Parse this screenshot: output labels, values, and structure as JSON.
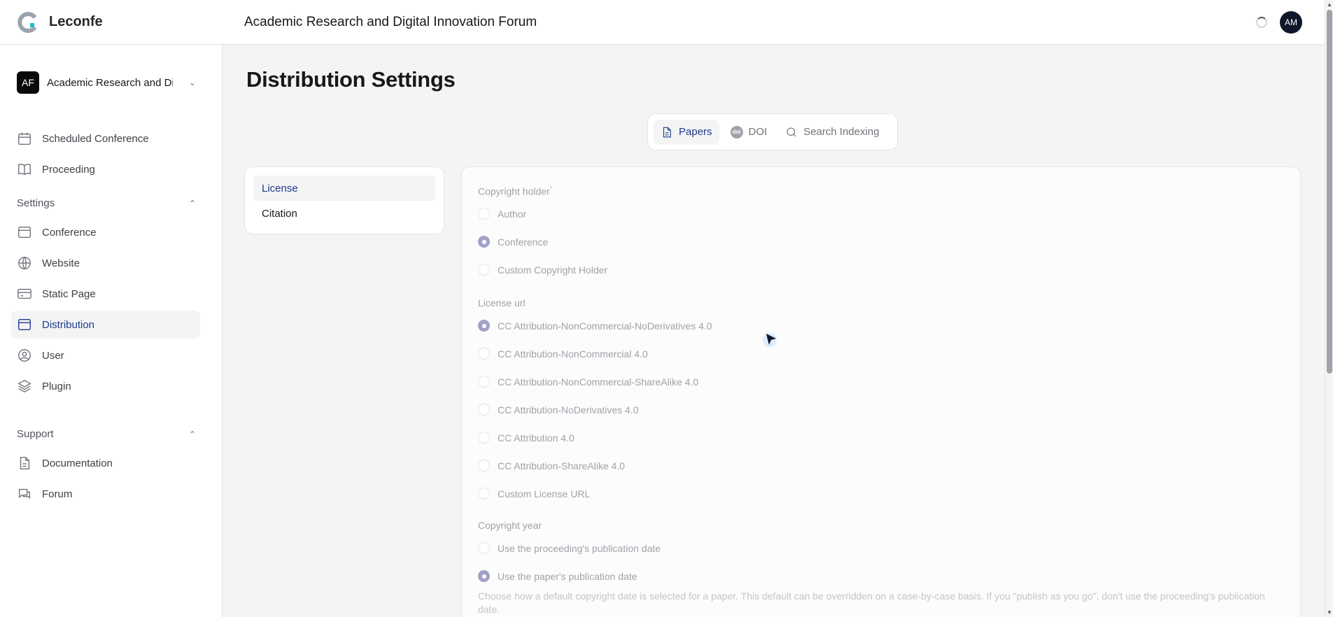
{
  "app": {
    "brand": "Leconfe",
    "forum_title": "Academic Research and Digital Innovation Forum",
    "avatar_initials": "AM"
  },
  "sidebar": {
    "conference": {
      "badge": "AF",
      "name": "Academic Research and Digital Innovation Forum"
    },
    "top_items": [
      {
        "label": "Scheduled Conference",
        "icon": "calendar-icon"
      },
      {
        "label": "Proceeding",
        "icon": "book-icon"
      }
    ],
    "settings_label": "Settings",
    "settings_items": [
      {
        "label": "Conference",
        "icon": "window-icon"
      },
      {
        "label": "Website",
        "icon": "globe-icon"
      },
      {
        "label": "Static Page",
        "icon": "card-icon"
      },
      {
        "label": "Distribution",
        "icon": "window-icon",
        "active": true
      },
      {
        "label": "User",
        "icon": "user-circle-icon"
      },
      {
        "label": "Plugin",
        "icon": "layers-icon"
      }
    ],
    "support_label": "Support",
    "support_items": [
      {
        "label": "Documentation",
        "icon": "document-icon"
      },
      {
        "label": "Forum",
        "icon": "chat-icon"
      }
    ]
  },
  "main": {
    "title": "Distribution Settings",
    "tabs": [
      {
        "label": "Papers",
        "icon": "document-icon",
        "active": true
      },
      {
        "label": "DOI",
        "icon": "doi-icon"
      },
      {
        "label": "Search Indexing",
        "icon": "search-icon"
      }
    ],
    "doi_icon_text": "doi",
    "subnav": [
      {
        "label": "License",
        "active": true
      },
      {
        "label": "Citation"
      }
    ],
    "form": {
      "copyright_holder": {
        "label": "Copyright holder",
        "required_mark": "*",
        "options": [
          "Author",
          "Conference",
          "Custom Copyright Holder"
        ],
        "selected": "Conference"
      },
      "license_url": {
        "label": "License url",
        "options": [
          "CC Attribution-NonCommercial-NoDerivatives 4.0",
          "CC Attribution-NonCommercial 4.0",
          "CC Attribution-NonCommercial-ShareAlike 4.0",
          "CC Attribution-NoDerivatives 4.0",
          "CC Attribution 4.0",
          "CC Attribution-ShareAlike 4.0",
          "Custom License URL"
        ],
        "selected": "CC Attribution-NonCommercial-NoDerivatives 4.0"
      },
      "copyright_year": {
        "label": "Copyright year",
        "options": [
          "Use the proceeding's publication date",
          "Use the paper's publication date"
        ],
        "selected": "Use the paper's publication date",
        "help": "Choose how a default copyright date is selected for a paper. This default can be overridden on a case-by-case basis. If you \"publish as you go\", don't use the proceeding's publication date."
      }
    }
  }
}
